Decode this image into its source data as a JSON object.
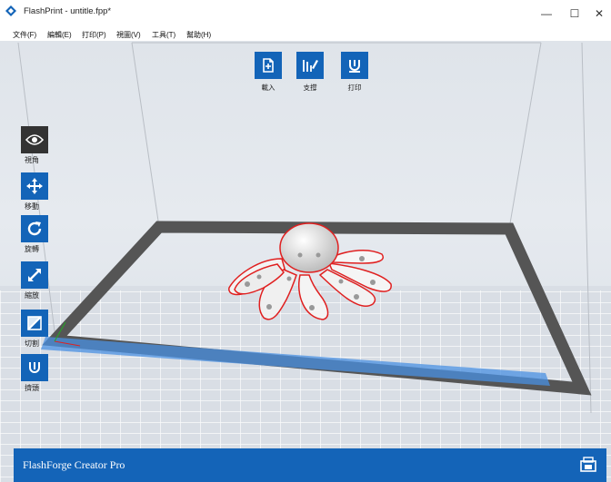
{
  "window": {
    "title": "FlashPrint - untitle.fpp*",
    "controls": {
      "minimize": "—",
      "maximize": "☐",
      "close": "✕"
    }
  },
  "menubar": {
    "items": [
      "文件(F)",
      "編輯(E)",
      "打印(P)",
      "視圖(V)",
      "工具(T)",
      "幫助(H)"
    ]
  },
  "toolbar_top": {
    "buttons": [
      {
        "label": "載入",
        "icon": "load-file-icon"
      },
      {
        "label": "支撐",
        "icon": "supports-icon"
      },
      {
        "label": "打印",
        "icon": "print-icon"
      }
    ]
  },
  "toolbar_left": {
    "buttons": [
      {
        "label": "視角",
        "icon": "eye-icon"
      },
      {
        "label": "移動",
        "icon": "move-icon"
      },
      {
        "label": "旋轉",
        "icon": "rotate-icon"
      },
      {
        "label": "縮放",
        "icon": "scale-icon"
      },
      {
        "label": "切割",
        "icon": "cut-icon"
      },
      {
        "label": "擠頭",
        "icon": "extruder-icon"
      }
    ]
  },
  "status": {
    "printer_name": "FlashForge Creator Pro",
    "icon": "printer-connect-icon"
  },
  "colors": {
    "accent": "#1364b8",
    "viewport_bg": "#e4e8ed",
    "platform_border": "#555555",
    "highlight_strip": "#4a90e2",
    "model_outline": "#e02020"
  }
}
